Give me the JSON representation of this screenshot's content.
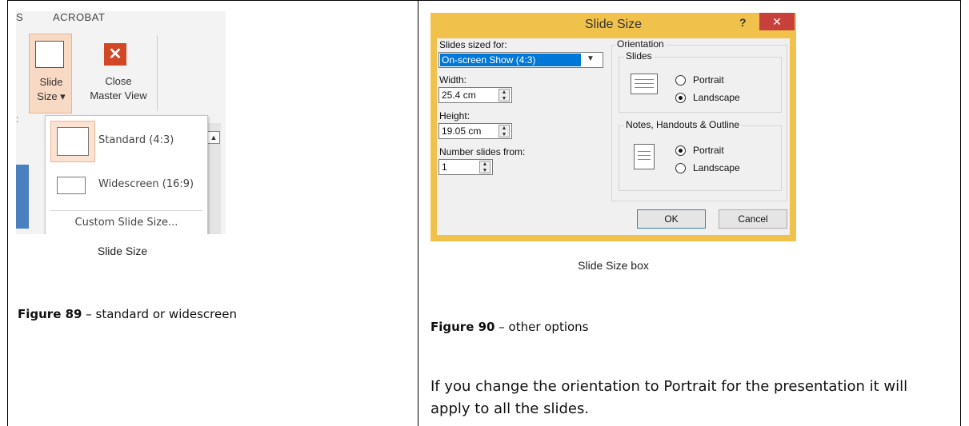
{
  "figure89": {
    "ribbon_tab_s": "S",
    "ribbon_tab_acrobat": "ACROBAT",
    "slide_size_line1": "Slide",
    "slide_size_line2": "Size ▾",
    "close_line1": "Close",
    "close_line2": "Master View",
    "close_glyph": "✕",
    "dropdown": {
      "standard": "Standard (4:3)",
      "widescreen": "Widescreen (16:9)",
      "custom": "Custom Slide Size..."
    },
    "caption": "Slide Size",
    "figure_label": "Figure 89",
    "figure_text": " – standard or widescreen"
  },
  "figure90": {
    "dialog_title": "Slide Size",
    "help_glyph": "?",
    "close_glyph": "✕",
    "slides_sized_for_label": "Slides sized for:",
    "slides_sized_for_value": "On-screen Show (4:3)",
    "width_label": "Width:",
    "width_value": "25.4 cm",
    "height_label": "Height:",
    "height_value": "19.05 cm",
    "number_from_label": "Number slides from:",
    "number_from_value": "1",
    "orientation_label": "Orientation",
    "slides_group_label": "Slides",
    "slides_portrait": "Portrait",
    "slides_landscape": "Landscape",
    "notes_group_label": "Notes, Handouts & Outline",
    "notes_portrait": "Portrait",
    "notes_landscape": "Landscape",
    "ok_label": "OK",
    "cancel_label": "Cancel",
    "caption": "Slide Size box",
    "figure_label": "Figure 90",
    "figure_text": " – other options"
  },
  "paragraph": "If you change the orientation to Portrait for the presentation it will apply to all the slides."
}
